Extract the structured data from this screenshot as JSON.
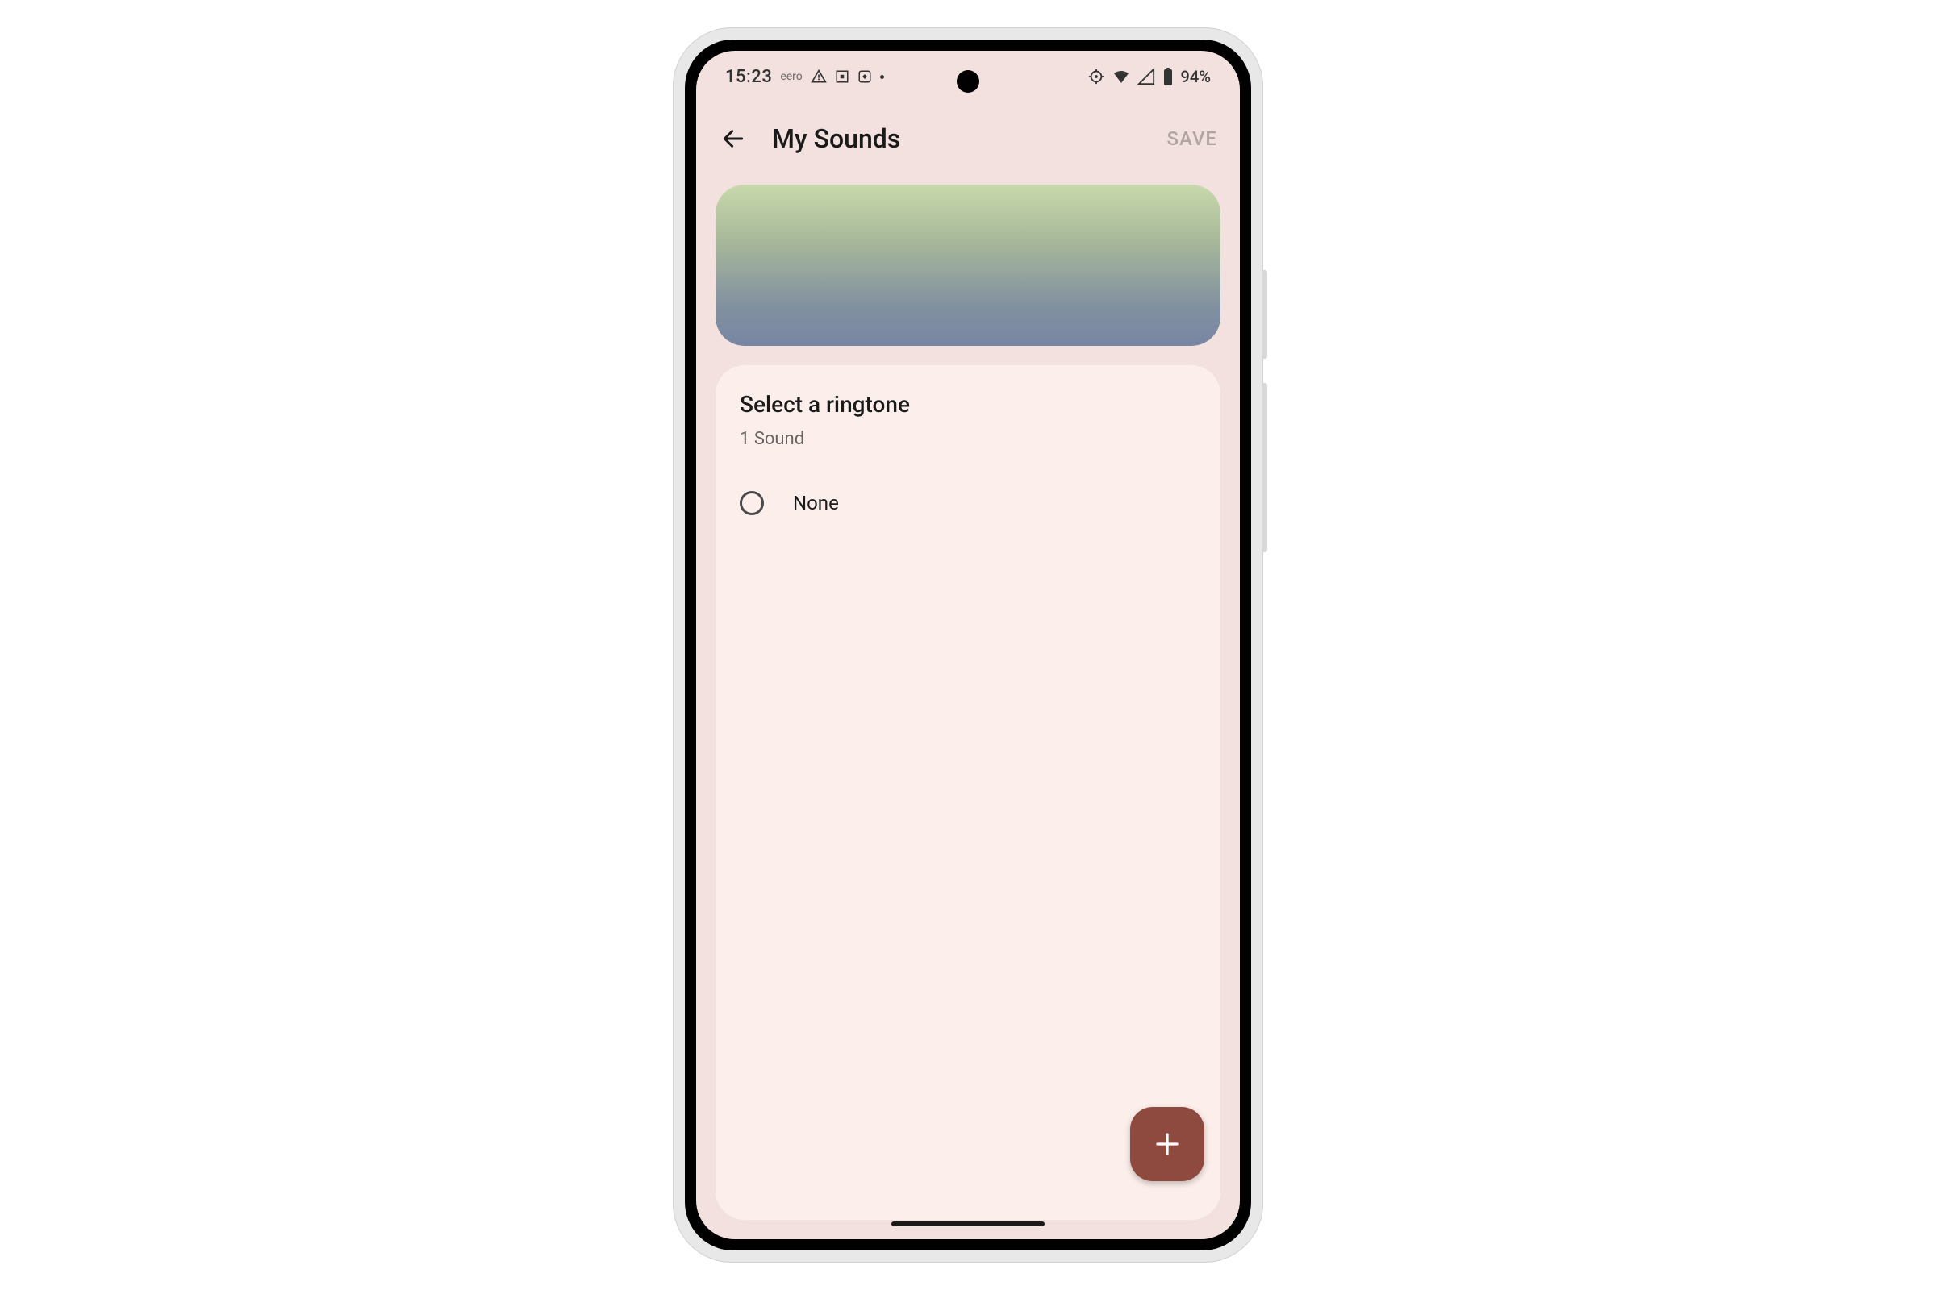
{
  "status": {
    "clock": "15:23",
    "carrier_small": "eero",
    "battery_pct": "94%"
  },
  "appbar": {
    "title": "My Sounds",
    "save_label": "SAVE"
  },
  "card": {
    "title": "Select a ringtone",
    "subtitle": "1 Sound"
  },
  "options": {
    "none_label": "None"
  }
}
